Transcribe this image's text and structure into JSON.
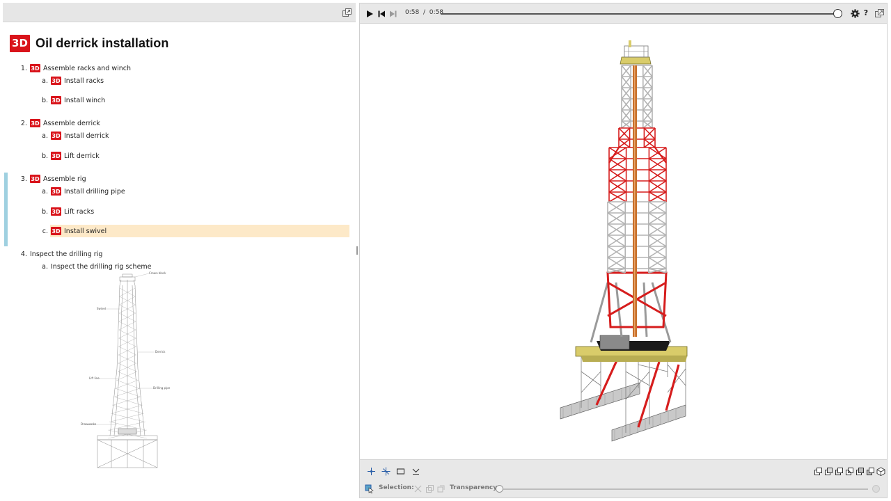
{
  "document": {
    "title": "Oil derrick installation",
    "badge": "3D",
    "steps": [
      {
        "num": "1.",
        "label": "Assemble racks and winch",
        "has3d": true,
        "substeps": [
          {
            "num": "a.",
            "label": "Install racks",
            "has3d": true
          },
          {
            "num": "b.",
            "label": "Install winch",
            "has3d": true
          }
        ]
      },
      {
        "num": "2.",
        "label": "Assemble derrick",
        "has3d": true,
        "substeps": [
          {
            "num": "a.",
            "label": "Install derrick",
            "has3d": true
          },
          {
            "num": "b.",
            "label": "Lift derrick",
            "has3d": true
          }
        ]
      },
      {
        "num": "3.",
        "label": "Assemble rig",
        "has3d": true,
        "active": true,
        "substeps": [
          {
            "num": "a.",
            "label": "Install drilling pipe",
            "has3d": true
          },
          {
            "num": "b.",
            "label": "Lift racks",
            "has3d": true
          },
          {
            "num": "c.",
            "label": "Install swivel",
            "has3d": true,
            "selected": true
          }
        ]
      },
      {
        "num": "4.",
        "label": "Inspect the drilling rig",
        "has3d": false,
        "substeps": [
          {
            "num": "a.",
            "label": "Inspect the drilling rig scheme",
            "has3d": false
          }
        ]
      }
    ],
    "scheme_callouts": [
      "Crown block",
      "Swivel",
      "Derrick",
      "Drilling pipe",
      "Lift line",
      "Drawworks"
    ]
  },
  "player": {
    "current_time": "0:58",
    "separator": "/",
    "total_time": "0:58",
    "progress": 1.0,
    "help_label": "?"
  },
  "toolbar": {
    "selection_label": "Selection:",
    "transparency_label": "Transparency:",
    "transparency_value": 0
  },
  "colors": {
    "badge_red": "#d9141b",
    "selected_row": "#fde9c8",
    "active_marker": "#9fd0e0",
    "derrick_red": "#d61d1d",
    "derrick_gray": "#b9b9b9",
    "platform_yellow": "#d9cc6a",
    "pipe_orange": "#c8702a"
  },
  "icons": [
    "play-icon",
    "skip-back-icon",
    "skip-forward-icon",
    "gear-icon",
    "help-icon",
    "fullscreen-icon",
    "expand-icon",
    "rotate-icon",
    "pan-icon",
    "zoom-box-icon",
    "fit-icon",
    "cube-view-icon",
    "selection-icon"
  ]
}
